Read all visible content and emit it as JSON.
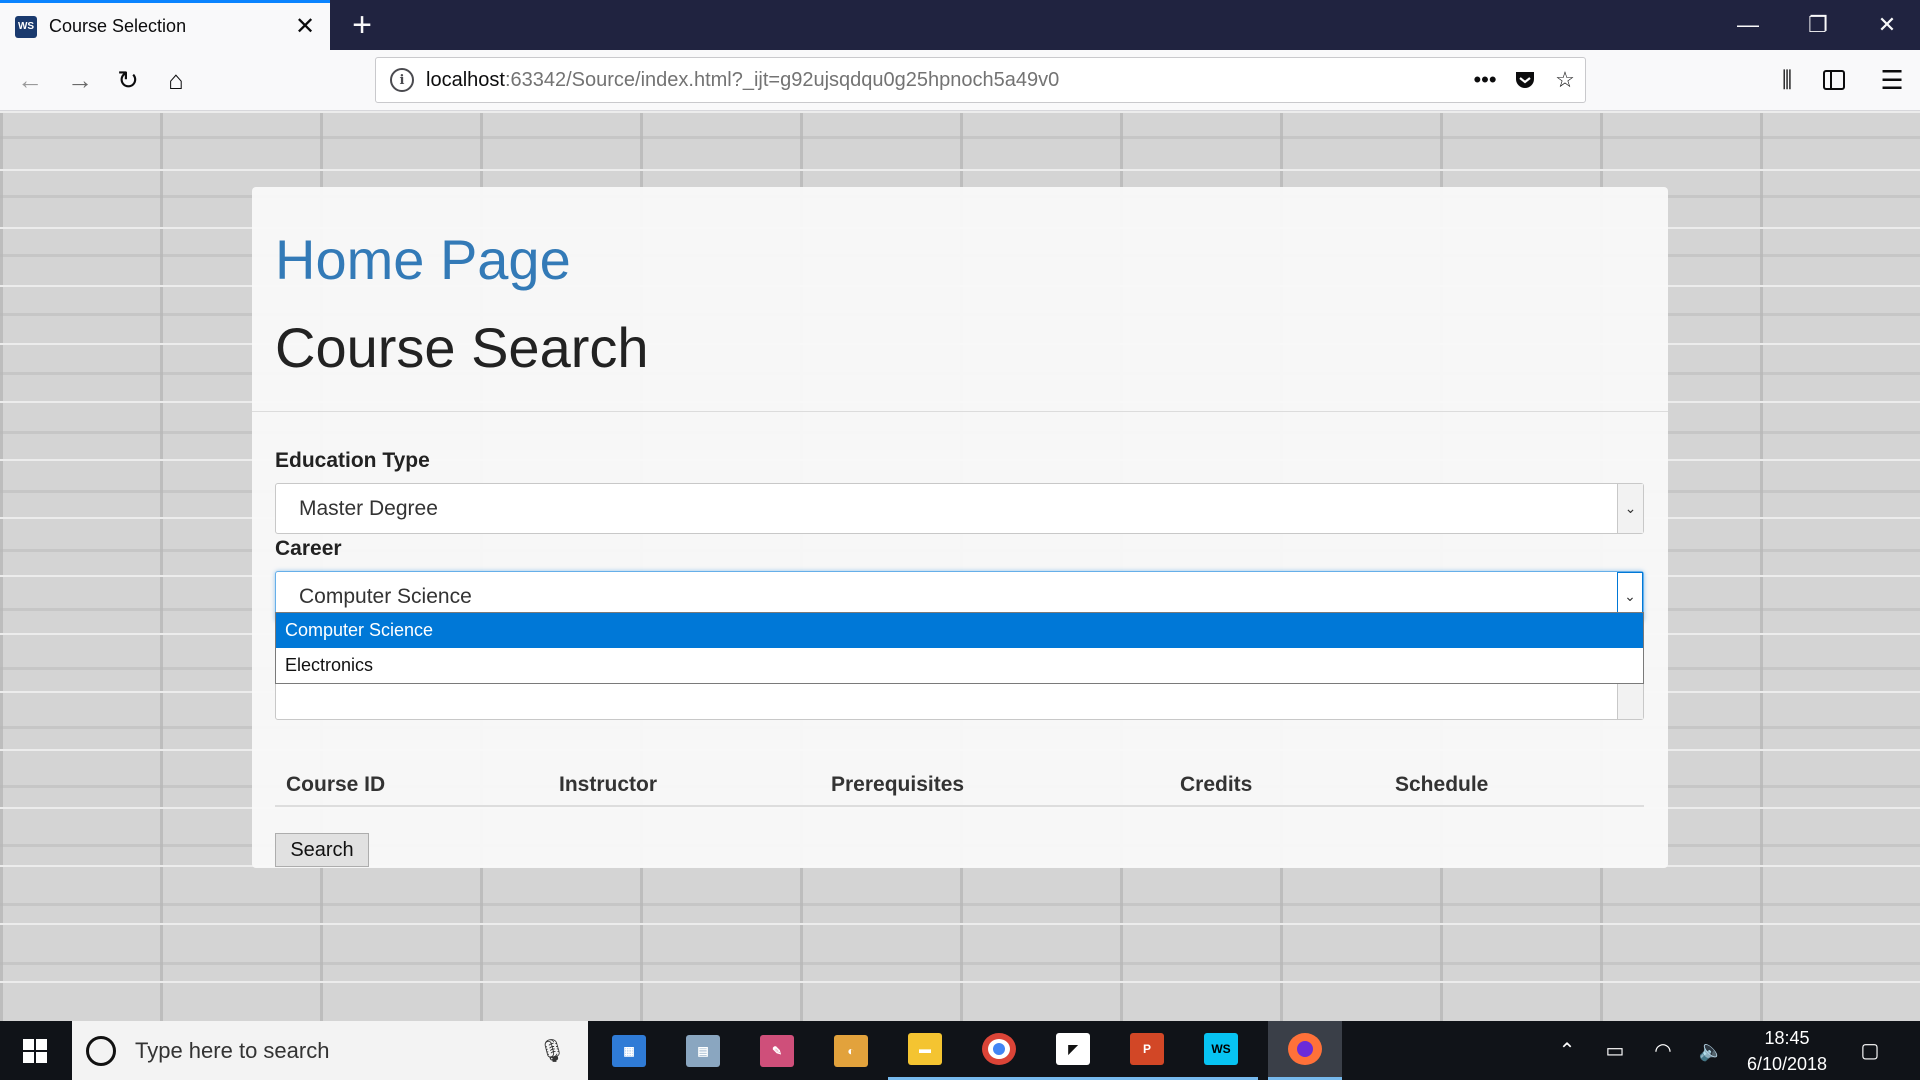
{
  "browser": {
    "tab_title": "Course Selection",
    "favicon_text": "WS",
    "url_host": "localhost",
    "url_rest": ":63342/Source/index.html?_ijt=g92ujsqdqu0g25hpnoch5a49v0"
  },
  "page": {
    "home_link": "Home Page",
    "title": "Course Search",
    "education_label": "Education Type",
    "education_value": "Master Degree",
    "career_label": "Career",
    "career_value": "Computer Science",
    "career_options": [
      "Computer Science",
      "Electronics"
    ],
    "search_button": "Search",
    "table_headers": [
      "Course ID",
      "Instructor",
      "Prerequisites",
      "Credits",
      "Schedule"
    ]
  },
  "taskbar": {
    "search_placeholder": "Type here to search",
    "time": "18:45",
    "date": "6/10/2018",
    "apps": [
      "control-panel-icon",
      "sticky-notes-icon",
      "paint-3d-icon",
      "paint-icon",
      "file-explorer-icon",
      "chrome-icon",
      "snip-icon",
      "powerpoint-icon",
      "webstorm-icon",
      "firefox-icon"
    ]
  },
  "colors": {
    "link": "#337ab7",
    "titlebar": "#202340",
    "selection": "#0078d7",
    "taskbar": "#101318"
  }
}
